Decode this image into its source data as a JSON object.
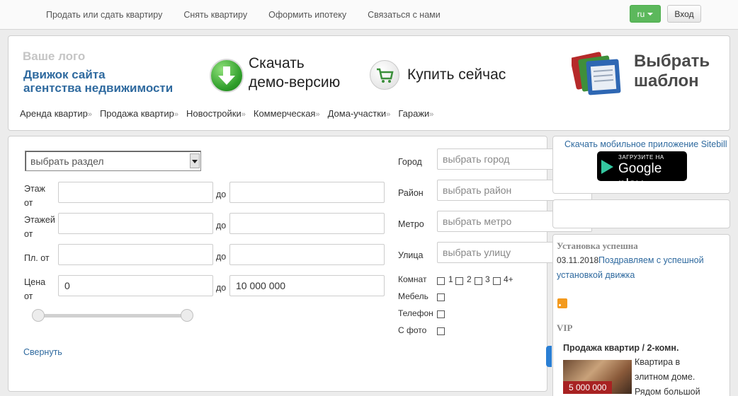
{
  "topnav": {
    "items": [
      "Продать или сдать квартиру",
      "Снять квартиру",
      "Оформить ипотеку",
      "Связаться с нами"
    ],
    "lang": "ru",
    "login": "Вход"
  },
  "header": {
    "logo_top": "Ваше лого",
    "logo_line1": "Движок сайта",
    "logo_line2": "агентства недвижимости",
    "download_line1": "Скачать",
    "download_line2": "демо-версию",
    "buy": "Купить сейчас",
    "template_line1": "Выбрать",
    "template_line2": "шаблон",
    "categories": [
      "Аренда квартир",
      "Продажа квартир",
      "Новостройки",
      "Коммерческая",
      "Дома-участки",
      "Гаражи"
    ],
    "cat_sep": "»"
  },
  "search": {
    "section_select": "выбрать раздел",
    "floor_label_1": "Этаж",
    "floor_label_2": "от",
    "floors_label_1": "Этажей",
    "floors_label_2": "от",
    "area_label": "Пл. от",
    "price_label_1": "Цена",
    "price_label_2": "от",
    "to": "до",
    "price_from": "0",
    "price_to": "10 000 000",
    "collapse": "Свернуть",
    "city_label": "Город",
    "city_placeholder": "выбрать город",
    "district_label": "Район",
    "district_placeholder": "выбрать район",
    "metro_label": "Метро",
    "metro_placeholder": "выбрать метро",
    "street_label": "Улица",
    "street_placeholder": "выбрать улицу",
    "rooms_label": "Комнат",
    "rooms": [
      "1",
      "2",
      "3",
      "4+"
    ],
    "furniture_label": "Мебель",
    "phone_label": "Телефон",
    "photo_label": "С фото"
  },
  "sidebar": {
    "app_link": "Скачать мобильное приложение Sitebill",
    "gplay_small": "ЗАГРУЗИТЕ НА",
    "gplay_big": "Google play",
    "news_title": "Установка успешна",
    "news_date": "03.11.2018",
    "news_text": "Поздравляем с успешной установкой движка",
    "vip_title": "VIP",
    "vip_item_title": "Продажа квартир / 2-комн.",
    "vip_price": "5 000 000",
    "vip_desc": "Квартира в элитном доме. Рядом большой"
  },
  "colors": {
    "link": "#2f6a9f",
    "green_button": "#5cb85c",
    "price_badge": "#a82222"
  }
}
